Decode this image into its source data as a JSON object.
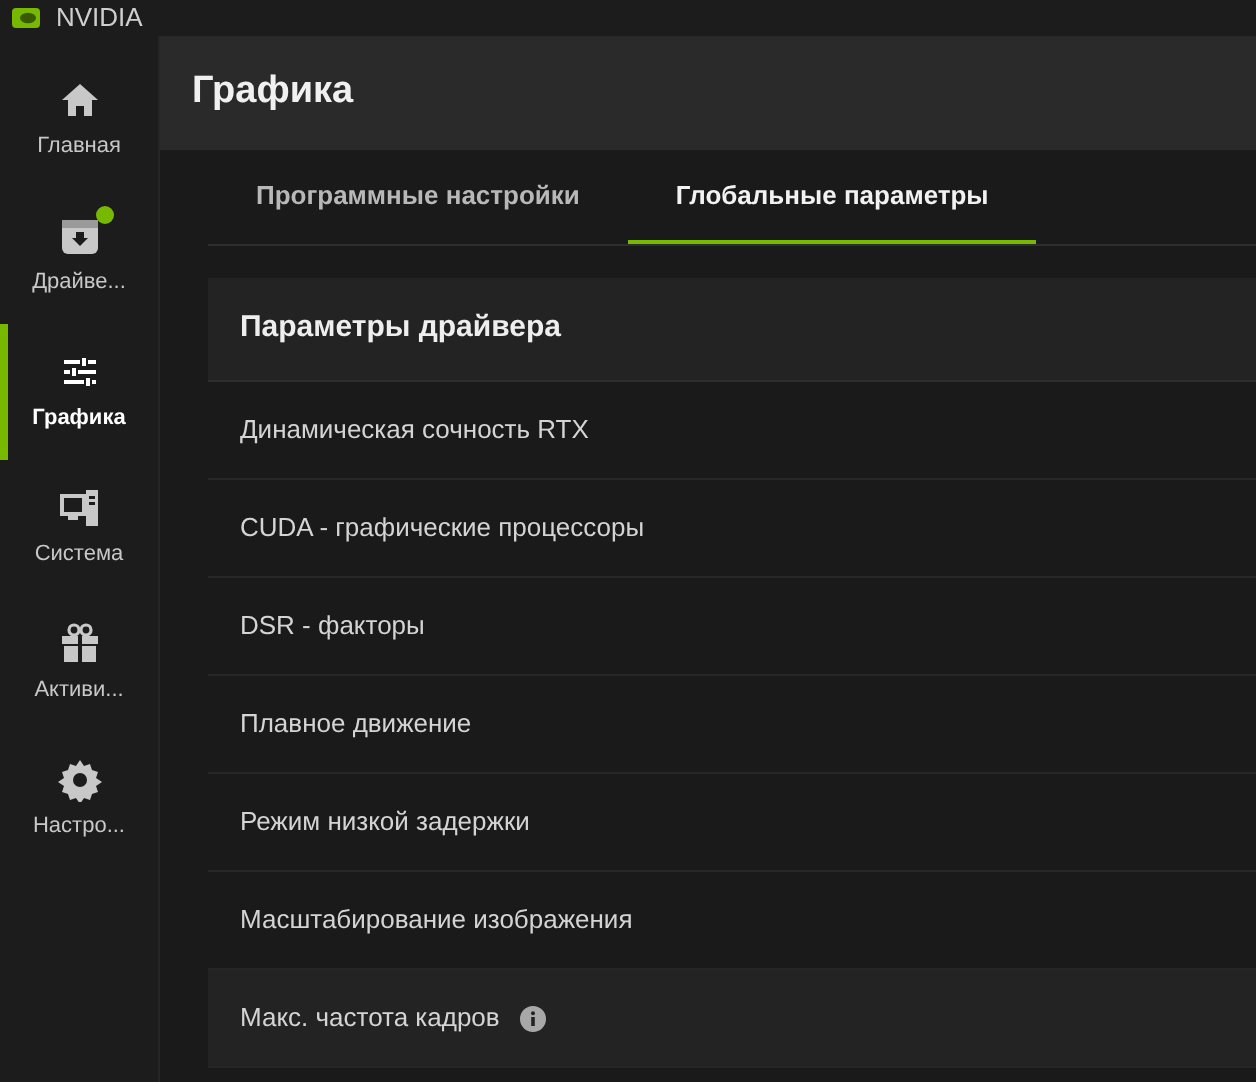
{
  "window": {
    "title": "NVIDIA"
  },
  "sidebar": {
    "items": [
      {
        "label": "Главная",
        "selected": false,
        "badge": false
      },
      {
        "label": "Драйве...",
        "selected": false,
        "badge": true
      },
      {
        "label": "Графика",
        "selected": true,
        "badge": false
      },
      {
        "label": "Система",
        "selected": false,
        "badge": false
      },
      {
        "label": "Активи...",
        "selected": false,
        "badge": false
      },
      {
        "label": "Настро...",
        "selected": false,
        "badge": false
      }
    ]
  },
  "page": {
    "title": "Графика"
  },
  "tabs": [
    {
      "label": "Программные настройки",
      "selected": false
    },
    {
      "label": "Глобальные параметры",
      "selected": true
    }
  ],
  "section": {
    "title": "Параметры драйвера",
    "rows": [
      {
        "label": "Динамическая сочность RTX",
        "highlighted": false,
        "info": false
      },
      {
        "label": "CUDA - графические процессоры",
        "highlighted": false,
        "info": false
      },
      {
        "label": "DSR - факторы",
        "highlighted": false,
        "info": false
      },
      {
        "label": "Плавное движение",
        "highlighted": false,
        "info": false
      },
      {
        "label": "Режим низкой задержки",
        "highlighted": false,
        "info": false
      },
      {
        "label": "Масштабирование изображения",
        "highlighted": false,
        "info": false
      },
      {
        "label": "Макс. частота кадров",
        "highlighted": true,
        "info": true
      }
    ]
  }
}
